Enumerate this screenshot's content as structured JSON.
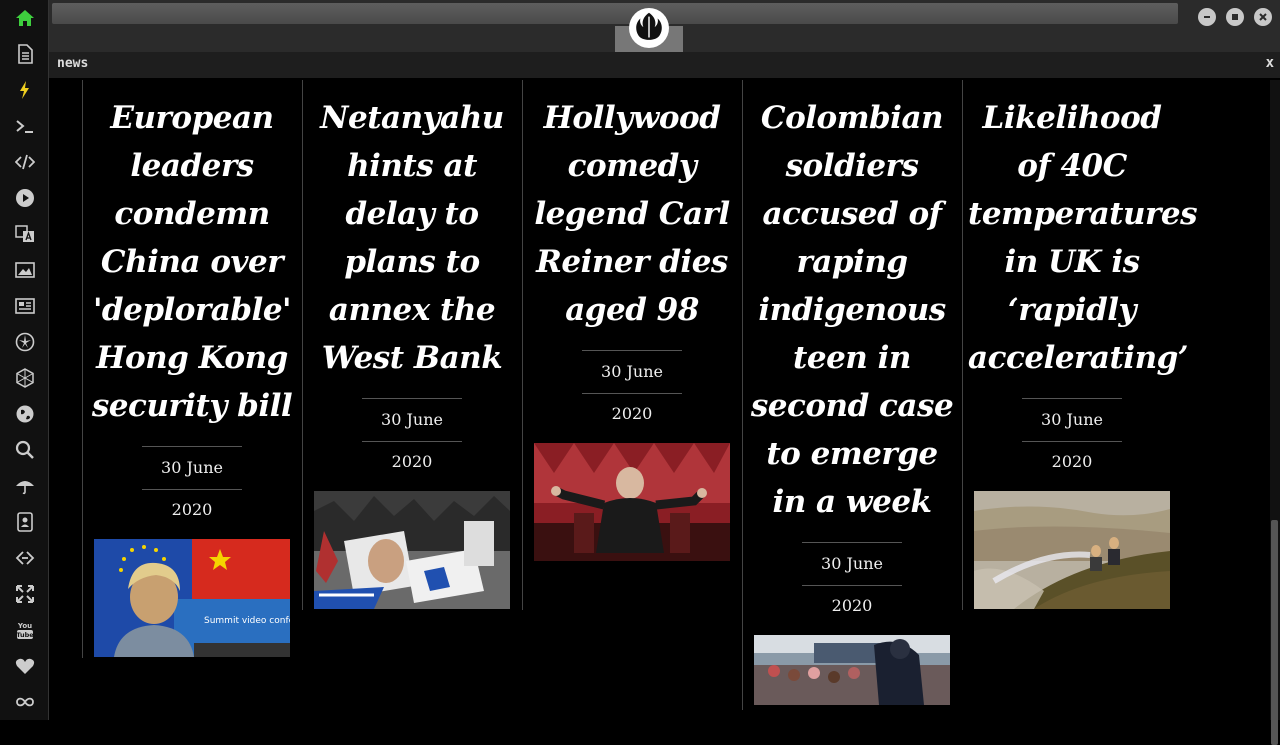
{
  "window": {
    "panel_title": "news",
    "close_label": "x"
  },
  "sidebar": {
    "items": [
      {
        "icon": "home-icon"
      },
      {
        "icon": "document-icon"
      },
      {
        "icon": "lightning-icon"
      },
      {
        "icon": "terminal-icon"
      },
      {
        "icon": "code-icon"
      },
      {
        "icon": "play-icon"
      },
      {
        "icon": "translate-icon"
      },
      {
        "icon": "image-icon"
      },
      {
        "icon": "newspaper-icon"
      },
      {
        "icon": "rebel-icon"
      },
      {
        "icon": "hexagon-icon"
      },
      {
        "icon": "globe-icon"
      },
      {
        "icon": "search-icon"
      },
      {
        "icon": "umbrella-icon"
      },
      {
        "icon": "contact-icon"
      },
      {
        "icon": "link-icon"
      },
      {
        "icon": "expand-icon"
      },
      {
        "icon": "youtube-icon"
      },
      {
        "icon": "heart-icon"
      },
      {
        "icon": "infinity-icon"
      }
    ],
    "active_color": "#3ecf3e",
    "accent_color": "#f0d020"
  },
  "articles": [
    {
      "headline": "European leaders condemn China over 'deplorable' Hong Kong security bill",
      "date": "30 June 2020",
      "image": "eu-china-press-photo"
    },
    {
      "headline": "Netanyahu hints at delay to plans to annex the West Bank",
      "date": "30 June 2020",
      "image": "protest-photo"
    },
    {
      "headline": "Hollywood comedy legend Carl Reiner dies aged 98",
      "date": "30 June 2020",
      "image": "carl-reiner-photo"
    },
    {
      "headline": "Colombian soldiers accused of raping indigenous teen in second case to emerge in a week",
      "date": "30 June 2020",
      "image": "colombia-protest-photo"
    },
    {
      "headline": "Likelihood of 40C temperatures in UK is ‘rapidly accelerating’",
      "date": "30 June 2020",
      "image": "uk-wildfire-photo"
    }
  ]
}
